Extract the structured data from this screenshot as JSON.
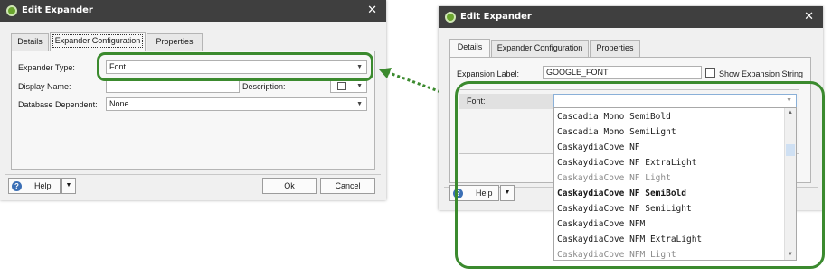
{
  "left_dialog": {
    "title": "Edit Expander",
    "close_glyph": "✕",
    "tabs": [
      "Details",
      "Expander Configuration",
      "Properties"
    ],
    "expander_type_label": "Expander Type:",
    "expander_type_value": "Font",
    "display_name_label": "Display Name:",
    "display_name_value": "",
    "description_label": "Description:",
    "database_dependent_label": "Database Dependent:",
    "database_dependent_value": "None",
    "help_label": "Help",
    "ok_label": "Ok",
    "cancel_label": "Cancel"
  },
  "right_dialog": {
    "title": "Edit Expander",
    "close_glyph": "✕",
    "tabs": [
      "Details",
      "Expander Configuration",
      "Properties"
    ],
    "expansion_label_label": "Expansion Label:",
    "expansion_label_value": "GOOGLE_FONT",
    "show_expansion_string_label": "Show Expansion String",
    "font_label": "Font:",
    "font_value": "",
    "help_label": "Help",
    "font_options": [
      "Cascadia Mono SemiBold",
      "Cascadia Mono SemiLight",
      "CaskaydiaCove NF",
      "CaskaydiaCove NF ExtraLight",
      "CaskaydiaCove NF Light",
      "CaskaydiaCove NF SemiBold",
      "CaskaydiaCove NF SemiLight",
      "CaskaydiaCove NFM",
      "CaskaydiaCove NFM ExtraLight",
      "CaskaydiaCove NFM Light"
    ]
  },
  "colors": {
    "highlight": "#3b8a2e",
    "titlebar": "#3f3f3f",
    "app_icon": "#6aa52e"
  },
  "icons": {
    "close": "close-icon",
    "help": "help-icon",
    "dropdown": "chevron-down-icon",
    "app": "app-icon",
    "arrow": "double-arrow-connector"
  }
}
